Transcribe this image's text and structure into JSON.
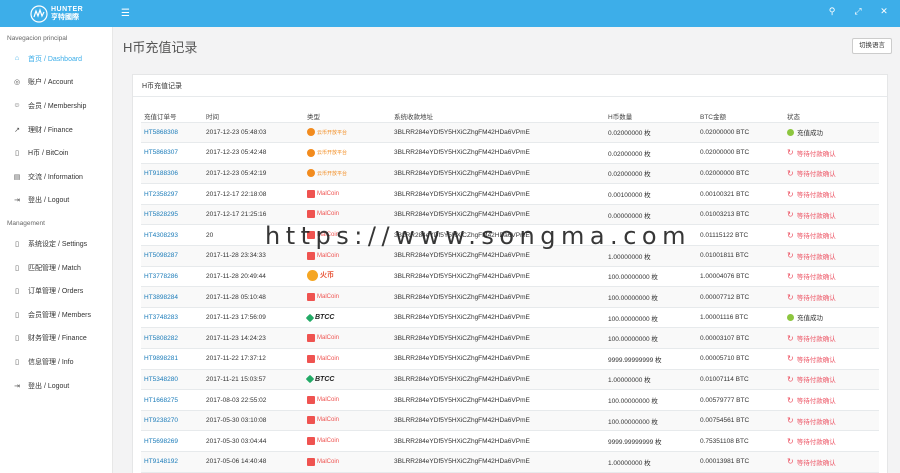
{
  "brand": {
    "name_en": "HUNTER",
    "name_cn": "亨特國際"
  },
  "topbar": {
    "icons": [
      "search-icon",
      "expand-icon",
      "close-icon"
    ]
  },
  "sidebar": {
    "section1": "Navegacion principal",
    "items1": [
      {
        "label": "首页 / Dashboard",
        "icon": "home-icon",
        "active": true
      },
      {
        "label": "账户 / Account",
        "icon": "coins-icon"
      },
      {
        "label": "会员 / Membership",
        "icon": "user-icon"
      },
      {
        "label": "理财 / Finance",
        "icon": "chart-icon"
      },
      {
        "label": "H币 / BitCoin",
        "icon": "file-icon"
      },
      {
        "label": "交流 / Information",
        "icon": "book-icon"
      },
      {
        "label": "登出 / Logout",
        "icon": "logout-icon"
      }
    ],
    "section2": "Management",
    "items2": [
      {
        "label": "系统设定 / Settings",
        "icon": "file-icon"
      },
      {
        "label": "匹配管理 / Match",
        "icon": "file-icon"
      },
      {
        "label": "订单管理 / Orders",
        "icon": "file-icon"
      },
      {
        "label": "会员管理 / Members",
        "icon": "file-icon"
      },
      {
        "label": "财务管理 / Finance",
        "icon": "file-icon"
      },
      {
        "label": "信息管理 / Info",
        "icon": "file-icon"
      },
      {
        "label": "登出 / Logout",
        "icon": "logout-icon"
      }
    ]
  },
  "page": {
    "title": "H币充值记录",
    "lang_button": "切换语言",
    "panel_title": "H币充值记录"
  },
  "table": {
    "headers": [
      "充值订单号",
      "时间",
      "类型",
      "系统收款地址",
      "H币数量",
      "BTC金额",
      "状态"
    ],
    "rows": [
      {
        "order": "HT5868308",
        "time": "2017-12-23 05:48:03",
        "type": "yunbi",
        "type_label": "云币开放平台",
        "address": "3BLRR284eYDf5Y5HXiCZhgFM42HDa6VPmE",
        "qty": "0.02000000 枚",
        "btc": "0.02000000 BTC",
        "status": "充值成功",
        "status_type": "success"
      },
      {
        "order": "HT5868307",
        "time": "2017-12-23 05:42:48",
        "type": "yunbi",
        "type_label": "云币开放平台",
        "address": "3BLRR284eYDf5Y5HXiCZhgFM42HDa6VPmE",
        "qty": "0.02000000 枚",
        "btc": "0.02000000 BTC",
        "status": "等待付款确认",
        "status_type": "pending"
      },
      {
        "order": "HT9188306",
        "time": "2017-12-23 05:42:19",
        "type": "yunbi",
        "type_label": "云币开放平台",
        "address": "3BLRR284eYDf5Y5HXiCZhgFM42HDa6VPmE",
        "qty": "0.02000000 枚",
        "btc": "0.02000000 BTC",
        "status": "等待付款确认",
        "status_type": "pending"
      },
      {
        "order": "HT2358297",
        "time": "2017-12-17 22:18:08",
        "type": "malcoin",
        "type_label": "MalCoin",
        "address": "3BLRR284eYDf5Y5HXiCZhgFM42HDa6VPmE",
        "qty": "0.00100000 枚",
        "btc": "0.00100321 BTC",
        "status": "等待付款确认",
        "status_type": "pending"
      },
      {
        "order": "HT5828295",
        "time": "2017-12-17 21:25:16",
        "type": "malcoin",
        "type_label": "MalCoin",
        "address": "3BLRR284eYDf5Y5HXiCZhgFM42HDa6VPmE",
        "qty": "0.00000000 枚",
        "btc": "0.01003213 BTC",
        "status": "等待付款确认",
        "status_type": "pending"
      },
      {
        "order": "HT4308293",
        "time": "20",
        "type": "malcoin",
        "type_label": "MalCoin",
        "address": "3BLRR284eYDf5Y5HXiCZhgFM42HDa6VPmE",
        "qty": "",
        "btc": "0.01115122 BTC",
        "status": "等待付款确认",
        "status_type": "pending"
      },
      {
        "order": "HT5098287",
        "time": "2017-11-28 23:34:33",
        "type": "malcoin",
        "type_label": "MalCoin",
        "address": "3BLRR284eYDf5Y5HXiCZhgFM42HDa6VPmE",
        "qty": "1.00000000 枚",
        "btc": "0.01001811 BTC",
        "status": "等待付款确认",
        "status_type": "pending"
      },
      {
        "order": "HT3778286",
        "time": "2017-11-28 20:49:44",
        "type": "huobi",
        "type_label": "火币",
        "address": "3BLRR284eYDf5Y5HXiCZhgFM42HDa6VPmE",
        "qty": "100.00000000 枚",
        "btc": "1.00004076 BTC",
        "status": "等待付款确认",
        "status_type": "pending"
      },
      {
        "order": "HT3898284",
        "time": "2017-11-28 05:10:48",
        "type": "malcoin",
        "type_label": "MalCoin",
        "address": "3BLRR284eYDf5Y5HXiCZhgFM42HDa6VPmE",
        "qty": "100.00000000 枚",
        "btc": "0.00007712 BTC",
        "status": "等待付款确认",
        "status_type": "pending"
      },
      {
        "order": "HT3748283",
        "time": "2017-11-23 17:56:09",
        "type": "btcc",
        "type_label": "BTCC",
        "address": "3BLRR284eYDf5Y5HXiCZhgFM42HDa6VPmE",
        "qty": "100.00000000 枚",
        "btc": "1.00001116 BTC",
        "status": "充值成功",
        "status_type": "success"
      },
      {
        "order": "HT5808282",
        "time": "2017-11-23 14:24:23",
        "type": "malcoin",
        "type_label": "MalCoin",
        "address": "3BLRR284eYDf5Y5HXiCZhgFM42HDa6VPmE",
        "qty": "100.00000000 枚",
        "btc": "0.00003107 BTC",
        "status": "等待付款确认",
        "status_type": "pending"
      },
      {
        "order": "HT9898281",
        "time": "2017-11-22 17:37:12",
        "type": "malcoin",
        "type_label": "MalCoin",
        "address": "3BLRR284eYDf5Y5HXiCZhgFM42HDa6VPmE",
        "qty": "9999.99999999 枚",
        "btc": "0.00005710 BTC",
        "status": "等待付款确认",
        "status_type": "pending"
      },
      {
        "order": "HT5348280",
        "time": "2017-11-21 15:03:57",
        "type": "btcc",
        "type_label": "BTCC",
        "address": "3BLRR284eYDf5Y5HXiCZhgFM42HDa6VPmE",
        "qty": "1.00000000 枚",
        "btc": "0.01007114 BTC",
        "status": "等待付款确认",
        "status_type": "pending"
      },
      {
        "order": "HT1668275",
        "time": "2017-08-03 22:55:02",
        "type": "malcoin",
        "type_label": "MalCoin",
        "address": "3BLRR284eYDf5Y5HXiCZhgFM42HDa6VPmE",
        "qty": "100.00000000 枚",
        "btc": "0.00579777 BTC",
        "status": "等待付款确认",
        "status_type": "pending"
      },
      {
        "order": "HT9238270",
        "time": "2017-05-30 03:10:08",
        "type": "malcoin",
        "type_label": "MalCoin",
        "address": "3BLRR284eYDf5Y5HXiCZhgFM42HDa6VPmE",
        "qty": "100.00000000 枚",
        "btc": "0.00754561 BTC",
        "status": "等待付款确认",
        "status_type": "pending"
      },
      {
        "order": "HT5698269",
        "time": "2017-05-30 03:04:44",
        "type": "malcoin",
        "type_label": "MalCoin",
        "address": "3BLRR284eYDf5Y5HXiCZhgFM42HDa6VPmE",
        "qty": "9999.99999999 枚",
        "btc": "0.75351108 BTC",
        "status": "等待付款确认",
        "status_type": "pending"
      },
      {
        "order": "HT9148192",
        "time": "2017-05-06 14:40:48",
        "type": "malcoin",
        "type_label": "MalCoin",
        "address": "3BLRR284eYDf5Y5HXiCZhgFM42HDa6VPmE",
        "qty": "1.00000000 枚",
        "btc": "0.00013981 BTC",
        "status": "等待付款确认",
        "status_type": "pending"
      }
    ]
  },
  "watermark": "https://www.songma.com",
  "colors": {
    "topbar": "#3daee9",
    "link": "#1a7bb9",
    "pending": "#ed5565",
    "success": "#8dc63f"
  }
}
